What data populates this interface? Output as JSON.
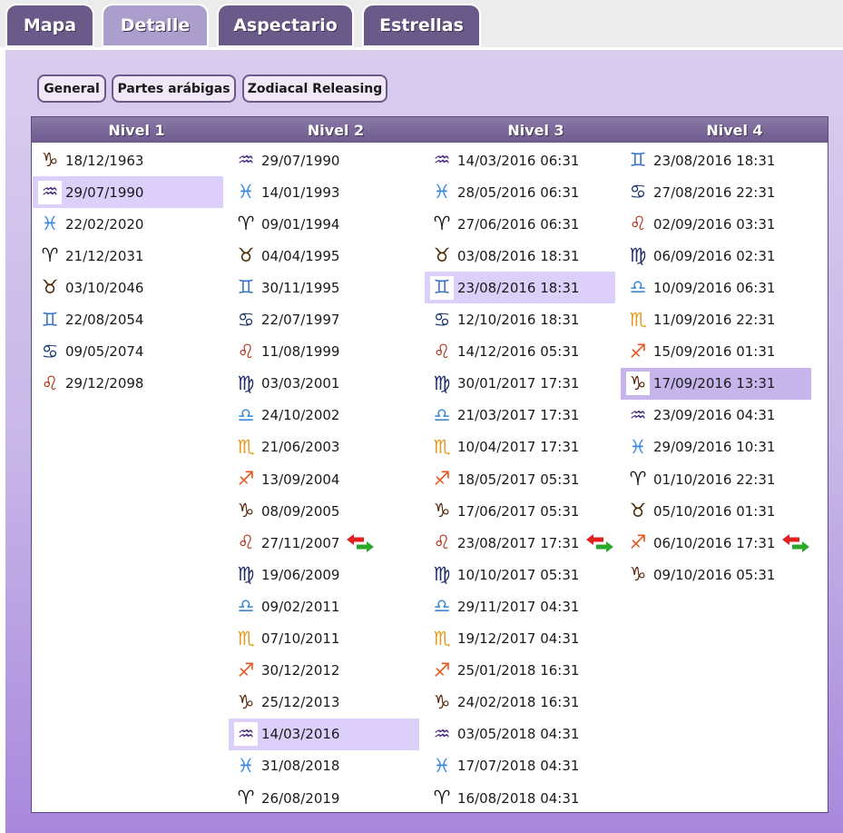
{
  "tabs": [
    {
      "label": "Mapa",
      "active": false
    },
    {
      "label": "Detalle",
      "active": true
    },
    {
      "label": "Aspectario",
      "active": false
    },
    {
      "label": "Estrellas",
      "active": false
    }
  ],
  "subtabs": [
    "General",
    "Partes arábigas",
    "Zodiacal Releasing"
  ],
  "columns": [
    {
      "header": "Nivel 1",
      "rows": [
        {
          "sign": "capricorn",
          "date": "18/12/1963"
        },
        {
          "sign": "aquarius",
          "date": "29/07/1990",
          "state": "selected"
        },
        {
          "sign": "pisces",
          "date": "22/02/2020"
        },
        {
          "sign": "aries",
          "date": "21/12/2031"
        },
        {
          "sign": "taurus",
          "date": "03/10/2046"
        },
        {
          "sign": "gemini",
          "date": "22/08/2054"
        },
        {
          "sign": "cancer",
          "date": "09/05/2074"
        },
        {
          "sign": "leo",
          "date": "29/12/2098"
        }
      ]
    },
    {
      "header": "Nivel 2",
      "rows": [
        {
          "sign": "aquarius",
          "date": "29/07/1990"
        },
        {
          "sign": "pisces",
          "date": "14/01/1993"
        },
        {
          "sign": "aries",
          "date": "09/01/1994"
        },
        {
          "sign": "taurus",
          "date": "04/04/1995"
        },
        {
          "sign": "gemini",
          "date": "30/11/1995"
        },
        {
          "sign": "cancer",
          "date": "22/07/1997"
        },
        {
          "sign": "leo",
          "date": "11/08/1999"
        },
        {
          "sign": "virgo",
          "date": "03/03/2001"
        },
        {
          "sign": "libra",
          "date": "24/10/2002"
        },
        {
          "sign": "scorpio",
          "date": "21/06/2003"
        },
        {
          "sign": "sagittarius",
          "date": "13/09/2004"
        },
        {
          "sign": "capricorn",
          "date": "08/09/2005"
        },
        {
          "sign": "leo",
          "date": "27/11/2007",
          "swap": true
        },
        {
          "sign": "virgo",
          "date": "19/06/2009"
        },
        {
          "sign": "libra",
          "date": "09/02/2011"
        },
        {
          "sign": "scorpio",
          "date": "07/10/2011"
        },
        {
          "sign": "sagittarius",
          "date": "30/12/2012"
        },
        {
          "sign": "capricorn",
          "date": "25/12/2013"
        },
        {
          "sign": "aquarius",
          "date": "14/03/2016",
          "state": "selected"
        },
        {
          "sign": "pisces",
          "date": "31/08/2018"
        },
        {
          "sign": "aries",
          "date": "26/08/2019"
        }
      ]
    },
    {
      "header": "Nivel 3",
      "rows": [
        {
          "sign": "aquarius",
          "date": "14/03/2016 06:31"
        },
        {
          "sign": "pisces",
          "date": "28/05/2016 06:31"
        },
        {
          "sign": "aries",
          "date": "27/06/2016 06:31"
        },
        {
          "sign": "taurus",
          "date": "03/08/2016 18:31"
        },
        {
          "sign": "gemini",
          "date": "23/08/2016 18:31",
          "state": "selected"
        },
        {
          "sign": "cancer",
          "date": "12/10/2016 18:31"
        },
        {
          "sign": "leo",
          "date": "14/12/2016 05:31"
        },
        {
          "sign": "virgo",
          "date": "30/01/2017 17:31"
        },
        {
          "sign": "libra",
          "date": "21/03/2017 17:31"
        },
        {
          "sign": "scorpio",
          "date": "10/04/2017 17:31"
        },
        {
          "sign": "sagittarius",
          "date": "18/05/2017 05:31"
        },
        {
          "sign": "capricorn",
          "date": "17/06/2017 05:31"
        },
        {
          "sign": "leo",
          "date": "23/08/2017 17:31",
          "swap": true
        },
        {
          "sign": "virgo",
          "date": "10/10/2017 05:31"
        },
        {
          "sign": "libra",
          "date": "29/11/2017 04:31"
        },
        {
          "sign": "scorpio",
          "date": "19/12/2017 04:31"
        },
        {
          "sign": "sagittarius",
          "date": "25/01/2018 16:31"
        },
        {
          "sign": "capricorn",
          "date": "24/02/2018 16:31"
        },
        {
          "sign": "aquarius",
          "date": "03/05/2018 04:31"
        },
        {
          "sign": "pisces",
          "date": "17/07/2018 04:31"
        },
        {
          "sign": "aries",
          "date": "16/08/2018 04:31"
        }
      ]
    },
    {
      "header": "Nivel 4",
      "rows": [
        {
          "sign": "gemini",
          "date": "23/08/2016 18:31"
        },
        {
          "sign": "cancer",
          "date": "27/08/2016 22:31"
        },
        {
          "sign": "leo",
          "date": "02/09/2016 03:31"
        },
        {
          "sign": "virgo",
          "date": "06/09/2016 02:31"
        },
        {
          "sign": "libra",
          "date": "10/09/2016 06:31"
        },
        {
          "sign": "scorpio",
          "date": "11/09/2016 22:31"
        },
        {
          "sign": "sagittarius",
          "date": "15/09/2016 01:31"
        },
        {
          "sign": "capricorn",
          "date": "17/09/2016 13:31",
          "state": "current"
        },
        {
          "sign": "aquarius",
          "date": "23/09/2016 04:31"
        },
        {
          "sign": "pisces",
          "date": "29/09/2016 10:31"
        },
        {
          "sign": "aries",
          "date": "01/10/2016 22:31"
        },
        {
          "sign": "taurus",
          "date": "05/10/2016 01:31"
        },
        {
          "sign": "sagittarius",
          "date": "06/10/2016 17:31",
          "swap": true
        },
        {
          "sign": "capricorn",
          "date": "09/10/2016 05:31"
        }
      ]
    }
  ],
  "signs": {
    "aries": {
      "glyph": "♈",
      "color": "#1a1a1a"
    },
    "taurus": {
      "glyph": "♉",
      "color": "#4a2a05"
    },
    "gemini": {
      "glyph": "♊",
      "color": "#3a72c8"
    },
    "cancer": {
      "glyph": "♋",
      "color": "#1a3a6a"
    },
    "leo": {
      "glyph": "♌",
      "color": "#b32a10"
    },
    "virgo": {
      "glyph": "♍",
      "color": "#1c2a6a"
    },
    "libra": {
      "glyph": "♎",
      "color": "#3a8ad8"
    },
    "scorpio": {
      "glyph": "♏",
      "color": "#e49a1a"
    },
    "sagittarius": {
      "glyph": "♐",
      "color": "#e8521a"
    },
    "capricorn": {
      "glyph": "♑",
      "color": "#5a2a10"
    },
    "aquarius": {
      "glyph": "♒",
      "color": "#4a2a7a"
    },
    "pisces": {
      "glyph": "♓",
      "color": "#3a8ae0"
    }
  },
  "colors": {
    "selected_row": "#dcd0fb",
    "current_row": "#c6b5ea",
    "tab_active": "#ab9dcc",
    "tab_inactive": "#6a5a8a",
    "swap_red": "#e02020",
    "swap_green": "#2aa82a"
  }
}
